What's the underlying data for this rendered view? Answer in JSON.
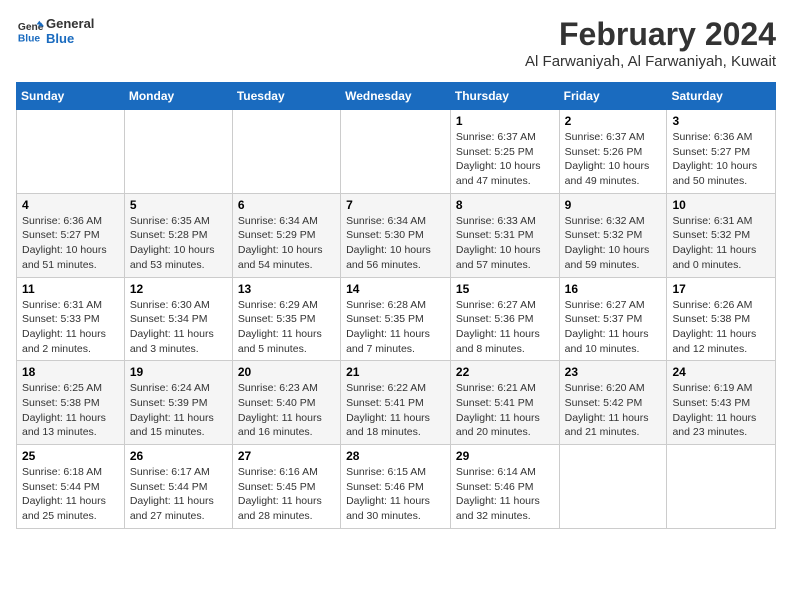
{
  "header": {
    "logo_line1": "General",
    "logo_line2": "Blue",
    "title": "February 2024",
    "subtitle": "Al Farwaniyah, Al Farwaniyah, Kuwait"
  },
  "weekdays": [
    "Sunday",
    "Monday",
    "Tuesday",
    "Wednesday",
    "Thursday",
    "Friday",
    "Saturday"
  ],
  "weeks": [
    [
      {
        "day": "",
        "info": ""
      },
      {
        "day": "",
        "info": ""
      },
      {
        "day": "",
        "info": ""
      },
      {
        "day": "",
        "info": ""
      },
      {
        "day": "1",
        "info": "Sunrise: 6:37 AM\nSunset: 5:25 PM\nDaylight: 10 hours\nand 47 minutes."
      },
      {
        "day": "2",
        "info": "Sunrise: 6:37 AM\nSunset: 5:26 PM\nDaylight: 10 hours\nand 49 minutes."
      },
      {
        "day": "3",
        "info": "Sunrise: 6:36 AM\nSunset: 5:27 PM\nDaylight: 10 hours\nand 50 minutes."
      }
    ],
    [
      {
        "day": "4",
        "info": "Sunrise: 6:36 AM\nSunset: 5:27 PM\nDaylight: 10 hours\nand 51 minutes."
      },
      {
        "day": "5",
        "info": "Sunrise: 6:35 AM\nSunset: 5:28 PM\nDaylight: 10 hours\nand 53 minutes."
      },
      {
        "day": "6",
        "info": "Sunrise: 6:34 AM\nSunset: 5:29 PM\nDaylight: 10 hours\nand 54 minutes."
      },
      {
        "day": "7",
        "info": "Sunrise: 6:34 AM\nSunset: 5:30 PM\nDaylight: 10 hours\nand 56 minutes."
      },
      {
        "day": "8",
        "info": "Sunrise: 6:33 AM\nSunset: 5:31 PM\nDaylight: 10 hours\nand 57 minutes."
      },
      {
        "day": "9",
        "info": "Sunrise: 6:32 AM\nSunset: 5:32 PM\nDaylight: 10 hours\nand 59 minutes."
      },
      {
        "day": "10",
        "info": "Sunrise: 6:31 AM\nSunset: 5:32 PM\nDaylight: 11 hours\nand 0 minutes."
      }
    ],
    [
      {
        "day": "11",
        "info": "Sunrise: 6:31 AM\nSunset: 5:33 PM\nDaylight: 11 hours\nand 2 minutes."
      },
      {
        "day": "12",
        "info": "Sunrise: 6:30 AM\nSunset: 5:34 PM\nDaylight: 11 hours\nand 3 minutes."
      },
      {
        "day": "13",
        "info": "Sunrise: 6:29 AM\nSunset: 5:35 PM\nDaylight: 11 hours\nand 5 minutes."
      },
      {
        "day": "14",
        "info": "Sunrise: 6:28 AM\nSunset: 5:35 PM\nDaylight: 11 hours\nand 7 minutes."
      },
      {
        "day": "15",
        "info": "Sunrise: 6:27 AM\nSunset: 5:36 PM\nDaylight: 11 hours\nand 8 minutes."
      },
      {
        "day": "16",
        "info": "Sunrise: 6:27 AM\nSunset: 5:37 PM\nDaylight: 11 hours\nand 10 minutes."
      },
      {
        "day": "17",
        "info": "Sunrise: 6:26 AM\nSunset: 5:38 PM\nDaylight: 11 hours\nand 12 minutes."
      }
    ],
    [
      {
        "day": "18",
        "info": "Sunrise: 6:25 AM\nSunset: 5:38 PM\nDaylight: 11 hours\nand 13 minutes."
      },
      {
        "day": "19",
        "info": "Sunrise: 6:24 AM\nSunset: 5:39 PM\nDaylight: 11 hours\nand 15 minutes."
      },
      {
        "day": "20",
        "info": "Sunrise: 6:23 AM\nSunset: 5:40 PM\nDaylight: 11 hours\nand 16 minutes."
      },
      {
        "day": "21",
        "info": "Sunrise: 6:22 AM\nSunset: 5:41 PM\nDaylight: 11 hours\nand 18 minutes."
      },
      {
        "day": "22",
        "info": "Sunrise: 6:21 AM\nSunset: 5:41 PM\nDaylight: 11 hours\nand 20 minutes."
      },
      {
        "day": "23",
        "info": "Sunrise: 6:20 AM\nSunset: 5:42 PM\nDaylight: 11 hours\nand 21 minutes."
      },
      {
        "day": "24",
        "info": "Sunrise: 6:19 AM\nSunset: 5:43 PM\nDaylight: 11 hours\nand 23 minutes."
      }
    ],
    [
      {
        "day": "25",
        "info": "Sunrise: 6:18 AM\nSunset: 5:44 PM\nDaylight: 11 hours\nand 25 minutes."
      },
      {
        "day": "26",
        "info": "Sunrise: 6:17 AM\nSunset: 5:44 PM\nDaylight: 11 hours\nand 27 minutes."
      },
      {
        "day": "27",
        "info": "Sunrise: 6:16 AM\nSunset: 5:45 PM\nDaylight: 11 hours\nand 28 minutes."
      },
      {
        "day": "28",
        "info": "Sunrise: 6:15 AM\nSunset: 5:46 PM\nDaylight: 11 hours\nand 30 minutes."
      },
      {
        "day": "29",
        "info": "Sunrise: 6:14 AM\nSunset: 5:46 PM\nDaylight: 11 hours\nand 32 minutes."
      },
      {
        "day": "",
        "info": ""
      },
      {
        "day": "",
        "info": ""
      }
    ]
  ]
}
